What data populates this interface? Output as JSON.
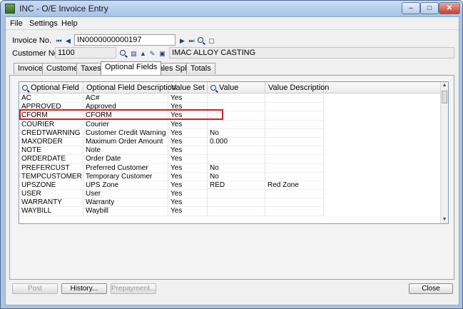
{
  "window": {
    "title": "INC - O/E Invoice Entry",
    "controls": {
      "minimize": "–",
      "maximize": "□",
      "close": "✕"
    }
  },
  "menu": [
    {
      "label": "File"
    },
    {
      "label": "Settings"
    },
    {
      "label": "Help"
    }
  ],
  "header": {
    "invoice_label": "Invoice No.",
    "invoice_value": "IN0000000000197",
    "customer_label": "Customer No.",
    "customer_value": "1100",
    "customer_name": "IMAC ALLOY CASTING"
  },
  "tabs": [
    {
      "label": "Invoice"
    },
    {
      "label": "Customer"
    },
    {
      "label": "Taxes"
    },
    {
      "label": "Optional Fields",
      "active": true
    },
    {
      "label": "Sales Split"
    },
    {
      "label": "Totals"
    }
  ],
  "grid": {
    "columns": [
      "Optional Field",
      "Optional Field Description",
      "Value Set",
      "Value",
      "Value Description"
    ],
    "rows": [
      {
        "field": "AC",
        "description": "AC#",
        "value_set": "Yes",
        "value": "",
        "value_description": ""
      },
      {
        "field": "APPROVED",
        "description": "Approved",
        "value_set": "Yes",
        "value": "",
        "value_description": ""
      },
      {
        "field": "CFORM",
        "description": "CFORM",
        "value_set": "Yes",
        "value": "",
        "value_description": ""
      },
      {
        "field": "COURIER",
        "description": "Courier",
        "value_set": "Yes",
        "value": "",
        "value_description": ""
      },
      {
        "field": "CREDTWARNING",
        "description": "Customer Credit Warning",
        "value_set": "Yes",
        "value": "No",
        "value_description": ""
      },
      {
        "field": "MAXORDER",
        "description": "Maximum Order Amount",
        "value_set": "Yes",
        "value": "0.000",
        "value_description": ""
      },
      {
        "field": "NOTE",
        "description": "Note",
        "value_set": "Yes",
        "value": "",
        "value_description": ""
      },
      {
        "field": "ORDERDATE",
        "description": "Order Date",
        "value_set": "Yes",
        "value": "",
        "value_description": ""
      },
      {
        "field": "PREFERCUST",
        "description": "Preferred Customer",
        "value_set": "Yes",
        "value": "No",
        "value_description": ""
      },
      {
        "field": "TEMPCUSTOMER",
        "description": "Temporary Customer",
        "value_set": "Yes",
        "value": "No",
        "value_description": ""
      },
      {
        "field": "UPSZONE",
        "description": "UPS Zone",
        "value_set": "Yes",
        "value": "RED",
        "value_description": "Red Zone"
      },
      {
        "field": "USER",
        "description": "User",
        "value_set": "Yes",
        "value": "",
        "value_description": ""
      },
      {
        "field": "WARRANTY",
        "description": "Warranty",
        "value_set": "Yes",
        "value": "",
        "value_description": ""
      },
      {
        "field": "WAYBILL",
        "description": "Waybill",
        "value_set": "Yes",
        "value": "",
        "value_description": ""
      }
    ]
  },
  "buttons": {
    "post": "Post",
    "history": "History...",
    "prepayment": "Prepayment...",
    "close": "Close"
  },
  "colors": {
    "highlight": "#d42020",
    "title_bar": "#a9c4e4",
    "nav_icon": "#1a3d8a"
  }
}
